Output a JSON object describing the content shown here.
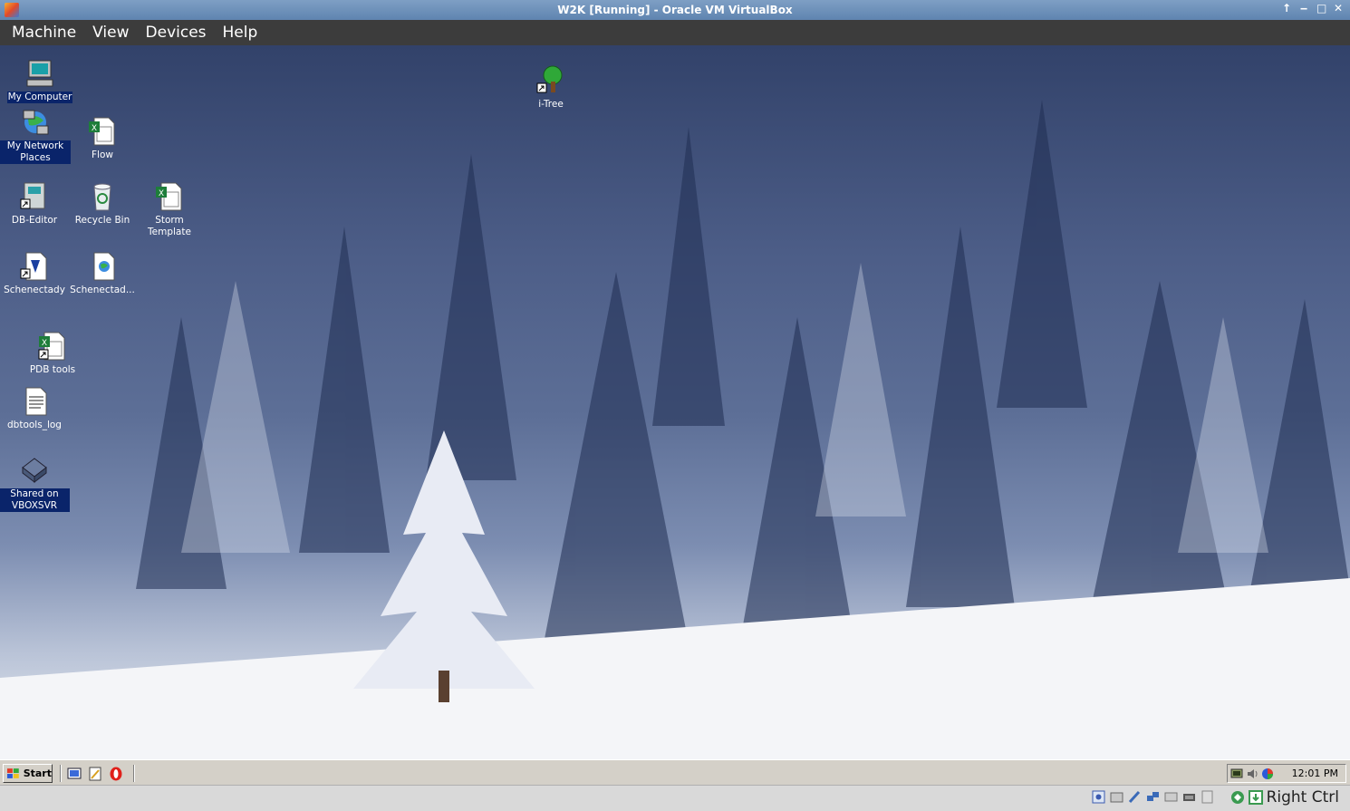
{
  "host_window": {
    "title": "W2K [Running] - Oracle VM VirtualBox",
    "controls": [
      "↑",
      "‒",
      "□",
      "✕"
    ]
  },
  "host_menu": [
    "Machine",
    "View",
    "Devices",
    "Help"
  ],
  "desktop_icons": [
    {
      "label": "My Computer",
      "icon": "computer-icon",
      "selected": true
    },
    {
      "label": "My Network Places",
      "icon": "network-places-icon",
      "selected": true
    },
    {
      "label": "Flow",
      "icon": "excel-file-icon",
      "selected": false
    },
    {
      "label": "DB-Editor",
      "icon": "db-editor-shortcut-icon",
      "selected": false
    },
    {
      "label": "Recycle Bin",
      "icon": "recycle-bin-icon",
      "selected": false
    },
    {
      "label": "Storm Template",
      "icon": "excel-file-icon",
      "selected": false
    },
    {
      "label": "Schenectady",
      "icon": "document-shortcut-icon",
      "selected": false
    },
    {
      "label": "Schenectad...",
      "icon": "web-document-icon",
      "selected": false
    },
    {
      "label": "PDB tools",
      "icon": "excel-shortcut-icon",
      "selected": false
    },
    {
      "label": "dbtools_log",
      "icon": "text-file-icon",
      "selected": false
    },
    {
      "label": "Shared on VBOXSVR",
      "icon": "network-drive-icon",
      "selected": true
    },
    {
      "label": "i-Tree",
      "icon": "tree-shortcut-icon",
      "selected": false
    }
  ],
  "taskbar": {
    "start_label": "Start",
    "clock": "12:01 PM"
  },
  "host_status": {
    "host_key": "Right Ctrl"
  },
  "colors": {
    "selection": "#0a246a",
    "taskbar": "#d4d0c8",
    "menubar": "#3c3c3c"
  }
}
